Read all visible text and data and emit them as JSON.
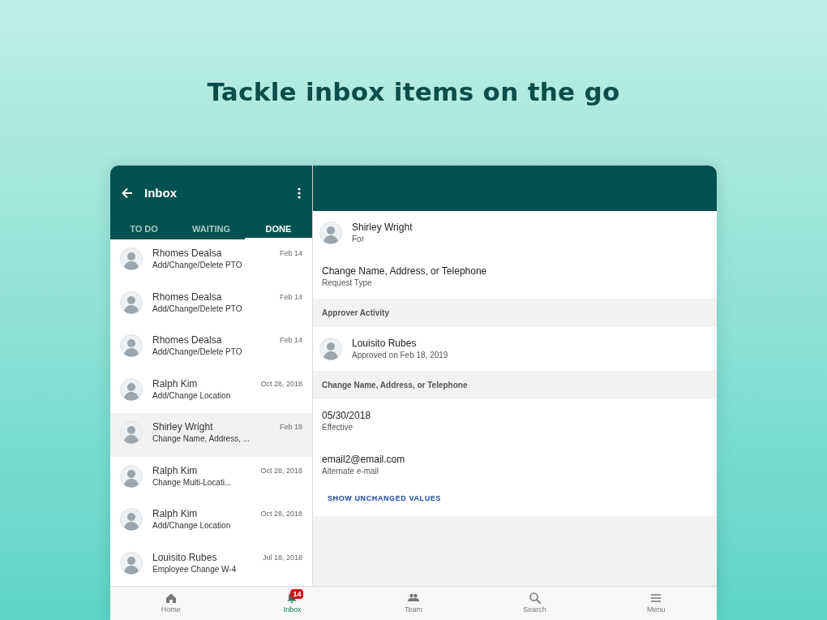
{
  "headline": "Tackle inbox items on the go",
  "inbox": {
    "title": "Inbox",
    "tabs": [
      {
        "label": "TO DO",
        "selected": false
      },
      {
        "label": "WAITING",
        "selected": false
      },
      {
        "label": "DONE",
        "selected": true
      }
    ],
    "items": [
      {
        "name": "Rhomes Dealsa",
        "subject": "Add/Change/Delete PTO",
        "date": "Feb 14",
        "selected": false
      },
      {
        "name": "Rhomes Dealsa",
        "subject": "Add/Change/Delete PTO",
        "date": "Feb 14",
        "selected": false
      },
      {
        "name": "Rhomes Dealsa",
        "subject": "Add/Change/Delete PTO",
        "date": "Feb 14",
        "selected": false
      },
      {
        "name": "Ralph Kim",
        "subject": "Add/Change Location",
        "date": "Oct 28, 2018",
        "selected": false
      },
      {
        "name": "Shirley Wright",
        "subject": "Change Name, Address, ...",
        "date": "Feb 18",
        "selected": true
      },
      {
        "name": "Ralph Kim",
        "subject": "Change Multi-Locati...",
        "date": "Oct 28, 2018",
        "selected": false
      },
      {
        "name": "Ralph Kim",
        "subject": "Add/Change Location",
        "date": "Oct 28, 2018",
        "selected": false
      },
      {
        "name": "Louisito Rubes",
        "subject": "Employee Change W-4",
        "date": "Jul 18, 2018",
        "selected": false
      }
    ]
  },
  "detail": [
    {
      "kind": "person",
      "value": "Shirley Wright",
      "caption": "For"
    },
    {
      "kind": "field",
      "value": "Change Name, Address, or Telephone",
      "caption": "Request Type"
    },
    {
      "kind": "header",
      "value": "Approver Activity"
    },
    {
      "kind": "person",
      "value": "Louisito Rubes",
      "caption": "Approved on Feb 18, 2019"
    },
    {
      "kind": "header",
      "value": "Change Name, Address, or Telephone"
    },
    {
      "kind": "field",
      "value": "05/30/2018",
      "caption": "Effective"
    },
    {
      "kind": "field",
      "value": "email2@email.com",
      "caption": "Alternate e-mail"
    },
    {
      "kind": "link",
      "value": "SHOW UNCHANGED VALUES"
    }
  ],
  "bottom_nav": [
    {
      "label": "Home",
      "selected": false
    },
    {
      "label": "Inbox",
      "selected": true,
      "badge": "14"
    },
    {
      "label": "Team",
      "selected": false
    },
    {
      "label": "Search",
      "selected": false
    },
    {
      "label": "Menu",
      "selected": false
    }
  ]
}
